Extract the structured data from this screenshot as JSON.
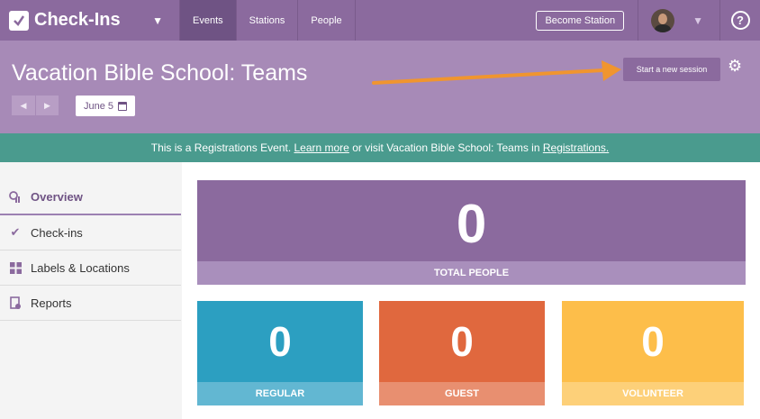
{
  "topnav": {
    "brand": "Check-Ins",
    "tabs": [
      "Events",
      "Stations",
      "People"
    ],
    "active_tab": "Events",
    "become_station": "Become Station",
    "help": "?"
  },
  "header": {
    "title": "Vacation Bible School: Teams",
    "date": "June 5",
    "session_button": "Start a new session"
  },
  "banner": {
    "prefix": "This is a Registrations Event. ",
    "learn_more": "Learn more",
    "middle": " or visit Vacation Bible School: Teams in ",
    "registrations": "Registrations."
  },
  "sidebar": {
    "items": [
      {
        "label": "Overview",
        "icon": "overview-icon"
      },
      {
        "label": "Check-ins",
        "icon": "check-icon"
      },
      {
        "label": "Labels & Locations",
        "icon": "grid-icon"
      },
      {
        "label": "Reports",
        "icon": "report-icon"
      }
    ]
  },
  "stats": {
    "total": {
      "value": "0",
      "label": "TOTAL PEOPLE"
    },
    "regular": {
      "value": "0",
      "label": "REGULAR"
    },
    "guest": {
      "value": "0",
      "label": "GUEST"
    },
    "volunteer": {
      "value": "0",
      "label": "VOLUNTEER"
    }
  },
  "colors": {
    "nav": "#8b6a9e",
    "header": "#a78ab7",
    "banner": "#4a9b8e",
    "regular": "#2c9fc1",
    "guest": "#e0683e",
    "volunteer": "#fdbe4a",
    "annotation_arrow": "#f0952f"
  }
}
